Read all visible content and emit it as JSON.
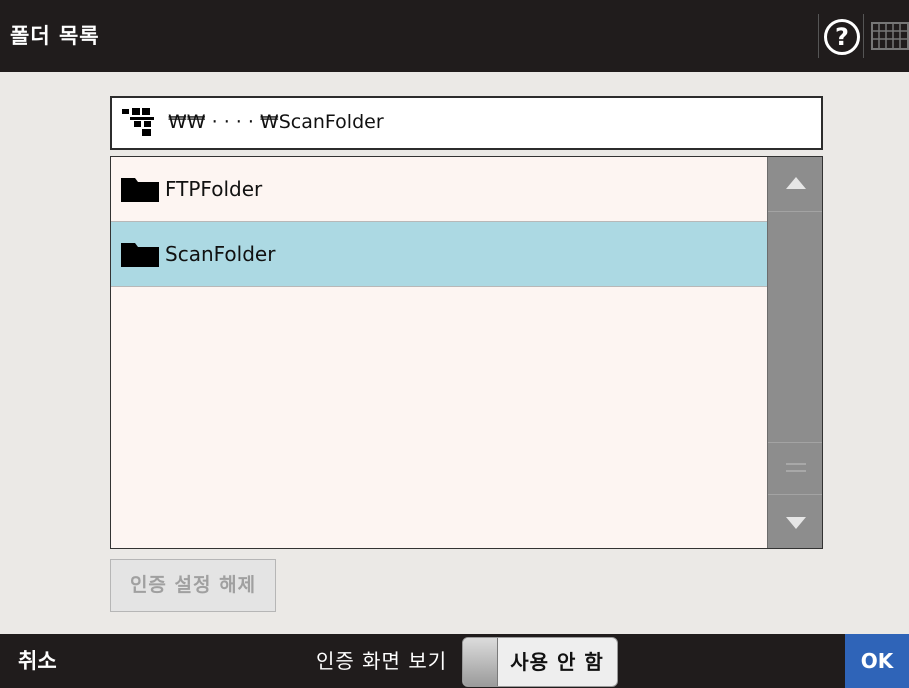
{
  "title": "폴더 목록",
  "header": {
    "help_label": "?",
    "help_icon": "question-circle",
    "keyboard_icon": "keyboard"
  },
  "path": {
    "icon": "network-icon",
    "text": "₩₩ ·  · ·  · ₩ScanFolder"
  },
  "folders": [
    {
      "label": "FTPFolder",
      "icon": "folder",
      "selected": false
    },
    {
      "label": "ScanFolder",
      "icon": "folder",
      "selected": true
    }
  ],
  "scrollbar": {
    "up_icon": "arrow-up",
    "down_icon": "arrow-down",
    "thumb_icon": "grip"
  },
  "buttons": {
    "clear_auth": "인증 설정 해제",
    "cancel": "취소",
    "ok": "OK"
  },
  "auth_screen": {
    "label": "인증 화면 보기",
    "toggle_value": "사용 안 함"
  },
  "colors": {
    "title_bar": "#201c1c",
    "selected_row": "#acd9e3",
    "list_background": "#fdf5f2",
    "ok_button": "#2f64b8"
  }
}
